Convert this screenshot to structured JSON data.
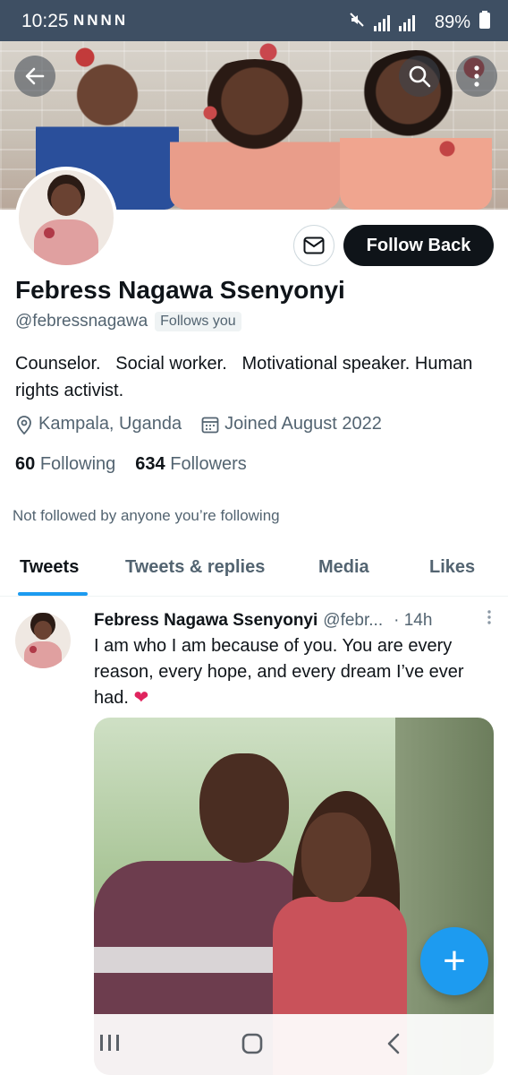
{
  "status_bar": {
    "time": "10:25",
    "notifications": "NNNN",
    "battery": "89%"
  },
  "profile": {
    "name": "Febress Nagawa Ssenyonyi",
    "handle": "@febressnagawa",
    "follows_you": "Follows you",
    "bio": "Counselor.   Social worker.   Motivational speaker. Human rights activist.",
    "location": "Kampala, Uganda",
    "joined": "Joined August 2022",
    "following_count": "60",
    "following_label": "Following",
    "followers_count": "634",
    "followers_label": "Followers",
    "not_followed": "Not followed by anyone you’re following",
    "follow_button": "Follow Back"
  },
  "tabs": [
    {
      "label": "Tweets",
      "active": true
    },
    {
      "label": "Tweets & replies",
      "active": false
    },
    {
      "label": "Media",
      "active": false
    },
    {
      "label": "Likes",
      "active": false
    }
  ],
  "tweet": {
    "name": "Febress Nagawa Ssenyonyi",
    "handle": "@febr...",
    "time": "· 14h",
    "text": "I am who I am because of you. You are every reason, every hope, and every dream I’ve ever had.",
    "heart": "❤"
  },
  "fab": {
    "label": "+"
  },
  "colors": {
    "accent": "#1d9bf0",
    "text_primary": "#0f1419",
    "text_secondary": "#536471",
    "status_bar": "#3e4f63"
  }
}
